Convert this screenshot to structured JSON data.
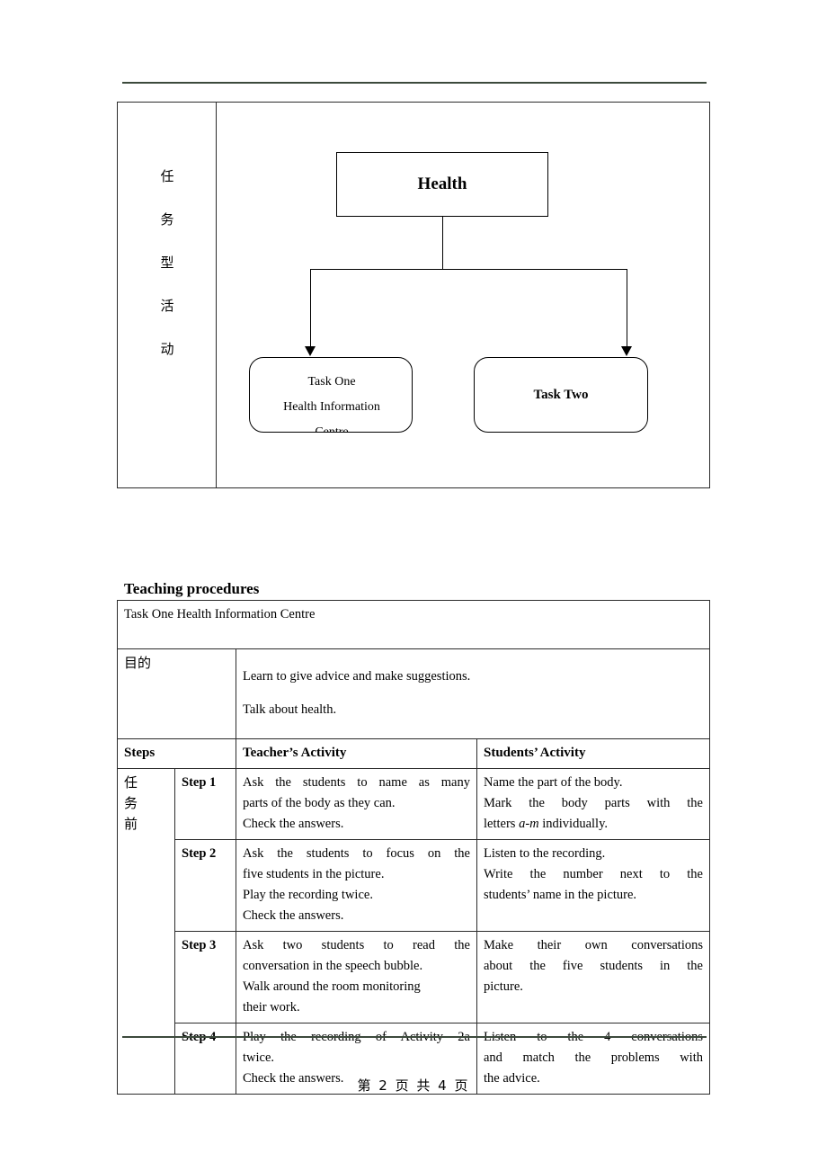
{
  "document": {
    "footer": "第 2 页 共 4 页"
  },
  "diagram": {
    "side_label_chars": [
      "任",
      "务",
      "型",
      "活",
      "动"
    ],
    "root_node": "Health",
    "task_one_lines": [
      "Task One",
      "Health Information",
      "Centre"
    ],
    "task_two": "Task Two"
  },
  "procedures": {
    "heading": "Teaching procedures",
    "task_title": "Task One    Health Information Centre",
    "purpose_label": "目的",
    "purpose_lines": [
      "Learn to give advice and make suggestions.",
      "Talk about health."
    ],
    "headers": {
      "steps": "Steps",
      "teacher": "Teacher’s Activity",
      "students": "Students’ Activity"
    },
    "phase_label_chars": [
      "任",
      "务",
      "前"
    ],
    "rows": [
      {
        "step": "Step 1",
        "teacher": [
          "Ask the students to name as many",
          "parts of the body as they can.",
          "Check the answers."
        ],
        "student": [
          "Name the part of the body.",
          "Mark the body parts with the",
          "letters a-m individually."
        ]
      },
      {
        "step": "Step 2",
        "teacher": [
          "Ask the students to focus on the",
          "five students in the picture.",
          "Play the recording twice.",
          "Check the answers."
        ],
        "student": [
          "Listen to the recording.",
          "Write the number next to the",
          "students’ name in the picture."
        ]
      },
      {
        "step": "Step 3",
        "teacher": [
          "Ask two students to read the",
          "conversation in the speech bubble.",
          "Walk around the room monitoring",
          "their work."
        ],
        "student": [
          "Make their own conversations",
          "about the five students in the",
          "picture."
        ]
      },
      {
        "step": "Step 4",
        "teacher": [
          "Play the recording of Activity 2a",
          "twice.",
          "Check the answers."
        ],
        "student": [
          "Listen to the 4 conversations",
          "and match the problems with",
          "the advice."
        ]
      }
    ]
  }
}
